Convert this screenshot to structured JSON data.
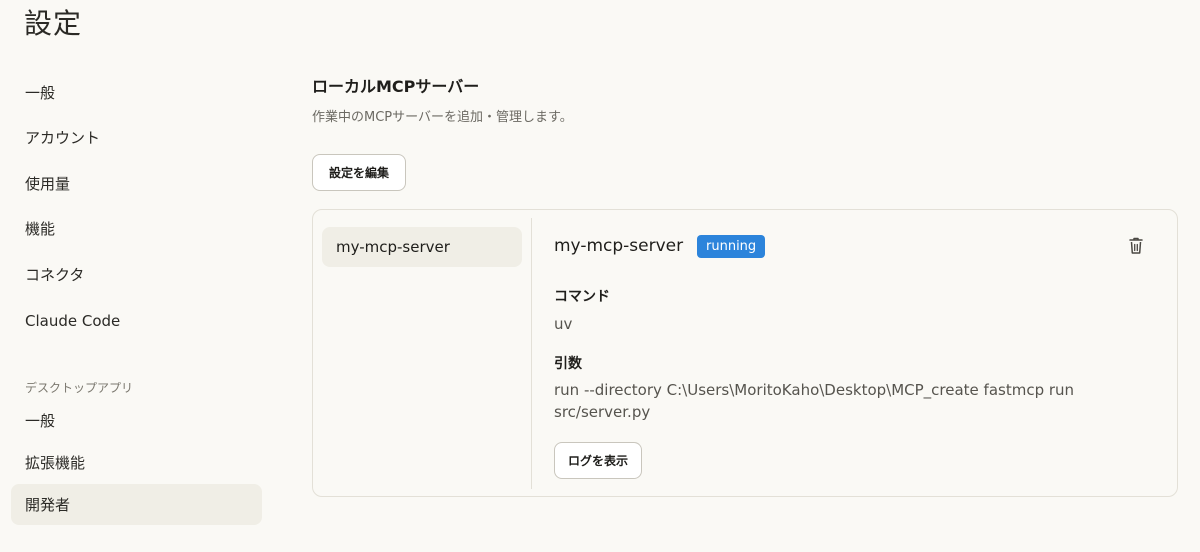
{
  "page": {
    "title": "設定"
  },
  "sidebar": {
    "items": [
      {
        "label": "一般"
      },
      {
        "label": "アカウント"
      },
      {
        "label": "使用量"
      },
      {
        "label": "機能"
      },
      {
        "label": "コネクタ"
      },
      {
        "label": "Claude Code"
      }
    ],
    "desktop_section_label": "デスクトップアプリ",
    "desktop_items": [
      {
        "label": "一般"
      },
      {
        "label": "拡張機能"
      },
      {
        "label": "開発者",
        "active": true
      }
    ]
  },
  "main": {
    "title": "ローカルMCPサーバー",
    "description": "作業中のMCPサーバーを追加・管理します。",
    "edit_button": "設定を編集",
    "servers": [
      {
        "name": "my-mcp-server",
        "selected": true
      }
    ],
    "detail": {
      "name": "my-mcp-server",
      "status": "running",
      "status_color": "#2c84db",
      "command_label": "コマンド",
      "command_value": "uv",
      "args_label": "引数",
      "args_value": "run --directory C:\\Users\\MoritoKaho\\Desktop\\MCP_create fastmcp run src/server.py",
      "log_button": "ログを表示",
      "delete_icon": "trash-icon"
    }
  }
}
